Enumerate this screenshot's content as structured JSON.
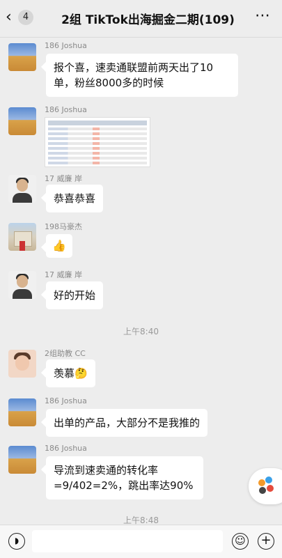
{
  "header": {
    "back_icon": "chevron-left-icon",
    "unread_count": "4",
    "title": "2组 TikTok出海掘金二期(109)",
    "more_icon": "more-icon"
  },
  "messages": [
    {
      "sender": "186 Joshua",
      "type": "text",
      "lines": [
        "报个喜，速卖通联盟前两天出了10",
        "单，粉丝8000多的时候"
      ]
    },
    {
      "sender": "186 Joshua",
      "type": "image"
    },
    {
      "sender": "17 威廉 岸",
      "type": "text",
      "text": "恭喜恭喜"
    },
    {
      "sender": "198马豪杰",
      "type": "emoji",
      "text": "👍"
    },
    {
      "sender": "17 威廉 岸",
      "type": "text",
      "text": "好的开始"
    },
    {
      "type": "time",
      "text": "上午8:40"
    },
    {
      "sender": "2组助教 CC",
      "type": "text",
      "text": "羡慕🤔"
    },
    {
      "sender": "186 Joshua",
      "type": "text",
      "text": "出单的产品，大部分不是我推的"
    },
    {
      "sender": "186 Joshua",
      "type": "text",
      "lines": [
        "导流到速卖通的转化率",
        "=9/402=2%，跳出率达90%"
      ]
    },
    {
      "type": "time",
      "text": "上午8:48"
    }
  ],
  "input_bar": {
    "voice_icon": "voice-icon",
    "input_value": "",
    "emoji_icon": "emoji-icon",
    "plus_icon": "plus-icon"
  }
}
